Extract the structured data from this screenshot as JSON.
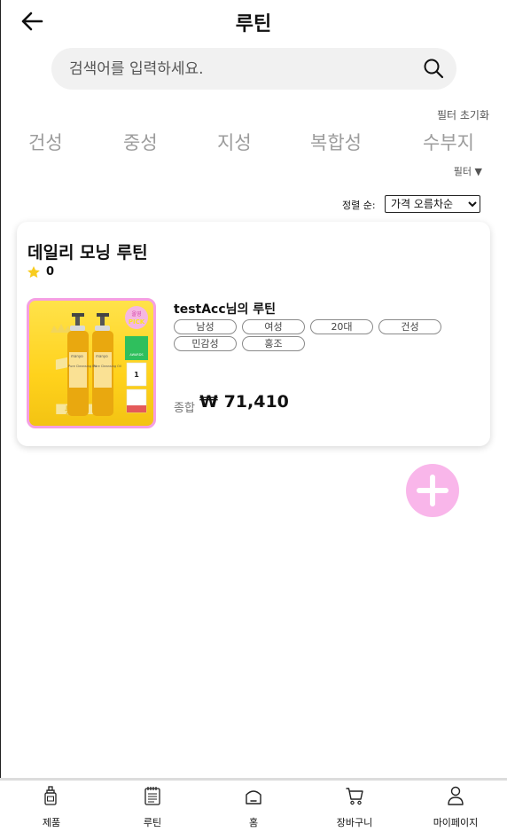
{
  "header": {
    "title": "루틴",
    "back_icon": "arrow-left-icon"
  },
  "search": {
    "placeholder": "검색어를 입력하세요.",
    "value": "",
    "icon": "search-icon"
  },
  "filters": {
    "reset_label": "필터 초기화",
    "skin_types": [
      "건성",
      "중성",
      "지성",
      "복합성",
      "수부지"
    ],
    "toggle_label": "필터 ▼"
  },
  "sort": {
    "label": "정렬 순:",
    "selected": "가격 오름차순"
  },
  "routines": [
    {
      "title": "데일리 모닝 루틴",
      "rating": "0",
      "owner": "testAcc님의 루틴",
      "tags": [
        "남성",
        "여성",
        "20대",
        "건성",
        "민감성",
        "홍조"
      ],
      "total_label": "종합",
      "total_price": "₩ 71,410",
      "thumbnail": {
        "badge_top": "올영",
        "badge_bottom": "PICK",
        "rank": "1",
        "rank_suffix": "등",
        "product_label": "Pure Cleansing Oil",
        "brand": "manyo",
        "side_tag": "AWARDS",
        "side_rank": "1"
      }
    }
  ],
  "fab": {
    "icon": "plus-icon"
  },
  "bottom_nav": [
    {
      "label": "제품",
      "icon": "product-icon"
    },
    {
      "label": "루틴",
      "icon": "routine-icon"
    },
    {
      "label": "홈",
      "icon": "home-icon"
    },
    {
      "label": "장바구니",
      "icon": "cart-icon"
    },
    {
      "label": "마이페이지",
      "icon": "user-icon"
    }
  ],
  "colors": {
    "accent": "#f9b6ea",
    "thumb_border": "#f59fe3",
    "star": "#f8cc1f",
    "muted": "#9c9c9c"
  }
}
